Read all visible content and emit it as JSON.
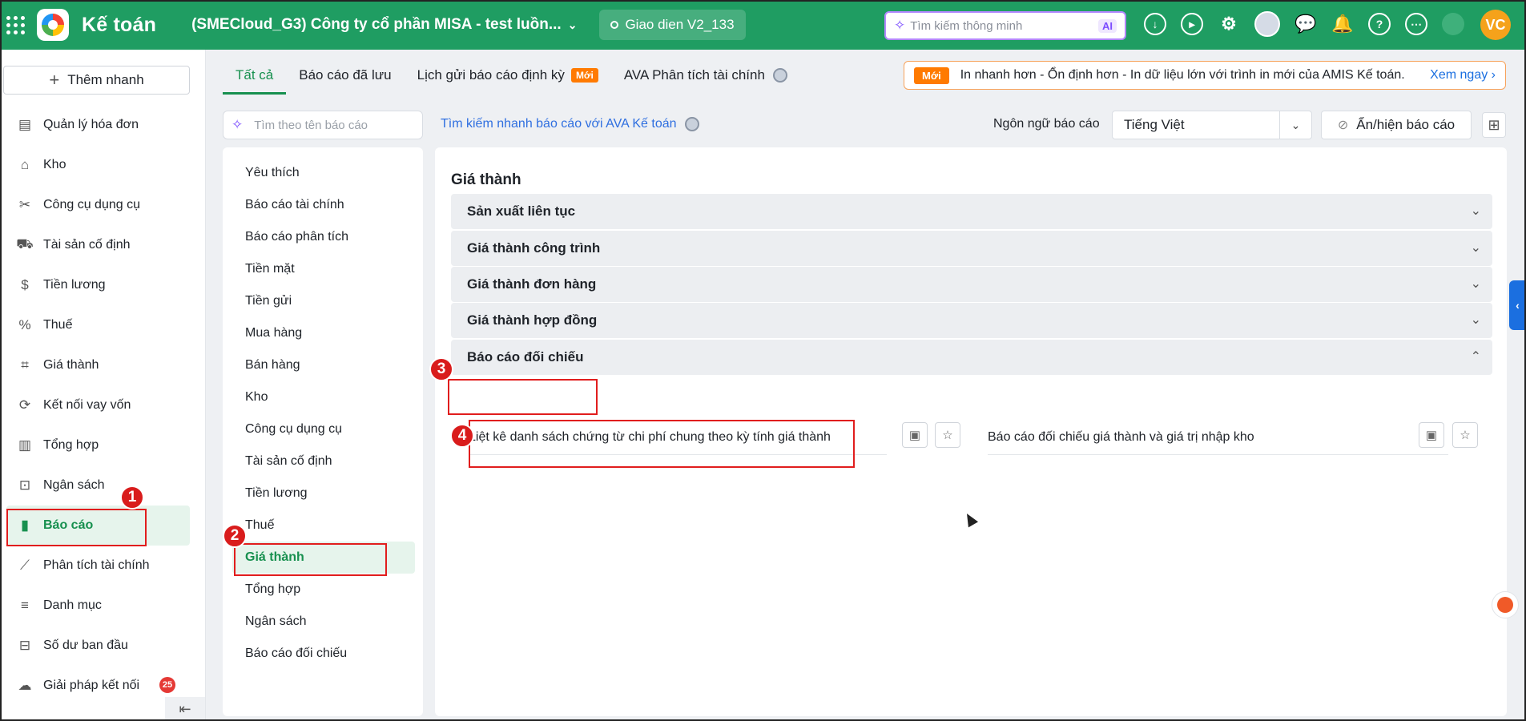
{
  "topbar": {
    "app_name": "Kế toán",
    "company": "(SMECloud_G3) Công ty cổ phần MISA - test luồn...",
    "ui_version": "Giao dien V2_133",
    "smart_search_placeholder": "Tìm kiếm thông minh",
    "ai_label": "AI",
    "user_initials": "VC",
    "icons": [
      "download-icon",
      "play-icon",
      "settings-icon",
      "ava-avatar",
      "chat-icon",
      "bell-icon",
      "help-icon",
      "more-icon",
      "user-icon"
    ]
  },
  "sidebar": {
    "quick_add": "Thêm nhanh",
    "items": [
      {
        "label": "Quản lý hóa đơn",
        "icon": "invoice-icon"
      },
      {
        "label": "Kho",
        "icon": "warehouse-icon"
      },
      {
        "label": "Công cụ dụng cụ",
        "icon": "tools-icon"
      },
      {
        "label": "Tài sản cố định",
        "icon": "car-icon"
      },
      {
        "label": "Tiền lương",
        "icon": "dollar-icon"
      },
      {
        "label": "Thuế",
        "icon": "tax-icon"
      },
      {
        "label": "Giá thành",
        "icon": "tag-icon"
      },
      {
        "label": "Kết nối vay vốn",
        "icon": "loan-icon"
      },
      {
        "label": "Tổng hợp",
        "icon": "book-icon"
      },
      {
        "label": "Ngân sách",
        "icon": "budget-icon"
      },
      {
        "label": "Báo cáo",
        "icon": "bar-chart-icon",
        "active": true
      },
      {
        "label": "Phân tích tài chính",
        "icon": "analytics-icon"
      },
      {
        "label": "Danh mục",
        "icon": "list-icon"
      },
      {
        "label": "Số dư ban đầu",
        "icon": "balance-icon"
      },
      {
        "label": "Giải pháp kết nối",
        "icon": "connect-icon"
      }
    ],
    "connect_badge": "25"
  },
  "tabs": [
    {
      "label": "Tất cả",
      "active": true
    },
    {
      "label": "Báo cáo đã lưu"
    },
    {
      "label": "Lịch gửi báo cáo định kỳ",
      "tag": "Mới"
    },
    {
      "label": "AVA Phân tích tài chính"
    }
  ],
  "promo": {
    "tag": "Mới",
    "text": "In nhanh hơn - Ổn định hơn - In dữ liệu lớn với trình in mới của AMIS Kế toán.",
    "link": "Xem ngay"
  },
  "search": {
    "placeholder": "Tìm theo tên báo cáo",
    "ava_link": "Tìm kiếm nhanh báo cáo với AVA Kế toán"
  },
  "language": {
    "label": "Ngôn ngữ báo cáo",
    "value": "Tiếng Việt"
  },
  "toggle_reports": "Ẩn/hiện báo cáo",
  "categories": [
    "Yêu thích",
    "Báo cáo tài chính",
    "Báo cáo phân tích",
    "Tiền mặt",
    "Tiền gửi",
    "Mua hàng",
    "Bán hàng",
    "Kho",
    "Công cụ dụng cụ",
    "Tài sản cố định",
    "Tiền lương",
    "Thuế",
    "Giá thành",
    "Tổng hợp",
    "Ngân sách",
    "Báo cáo đối chiếu"
  ],
  "main": {
    "title": "Giá thành",
    "groups": [
      {
        "label": "Sản xuất liên tục",
        "expanded": false
      },
      {
        "label": "Giá thành công trình",
        "expanded": false
      },
      {
        "label": "Giá thành đơn hàng",
        "expanded": false
      },
      {
        "label": "Giá thành hợp đồng",
        "expanded": false
      },
      {
        "label": "Báo cáo đối chiếu",
        "expanded": true
      }
    ],
    "reports": [
      "Liệt kê danh sách chứng từ chi phí chung theo kỳ tính giá thành",
      "Báo cáo đối chiếu giá thành và giá trị nhập kho"
    ]
  },
  "annotations": [
    "1",
    "2",
    "3",
    "4"
  ],
  "colors": {
    "brand": "#1f9d62",
    "active": "#17904f",
    "highlight": "#e11d1d",
    "new_tag": "#ff7a00"
  }
}
